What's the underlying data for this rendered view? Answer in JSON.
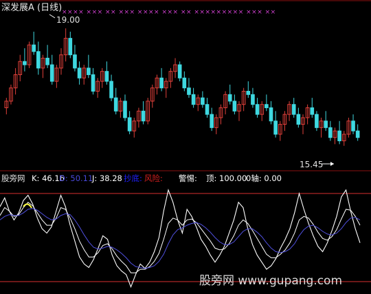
{
  "chart_data": [
    {
      "type": "candlestick",
      "title": "深发展A (日线)",
      "ylim": [
        14.8,
        19.4
      ],
      "high_label": "19.00",
      "low_label": "15.45",
      "colors": {
        "up": "#e0403a",
        "down": "#3fd8e0",
        "signal": "#d040d0"
      },
      "signal_row": "×××× ××× ×× ××× ×××× ××× ×× ××××××××× ××× ××",
      "candles": [
        [
          16.6,
          16.9,
          16.4,
          16.8
        ],
        [
          16.8,
          17.3,
          16.7,
          17.2
        ],
        [
          17.2,
          17.8,
          17.0,
          17.6
        ],
        [
          17.6,
          18.2,
          17.4,
          18.0
        ],
        [
          18.0,
          18.4,
          17.7,
          17.9
        ],
        [
          17.9,
          18.6,
          17.8,
          18.5
        ],
        [
          18.5,
          18.9,
          18.2,
          18.3
        ],
        [
          18.3,
          18.6,
          17.6,
          17.8
        ],
        [
          17.8,
          18.2,
          17.5,
          18.1
        ],
        [
          18.1,
          18.5,
          17.8,
          17.9
        ],
        [
          17.9,
          18.2,
          17.3,
          17.4
        ],
        [
          17.4,
          17.9,
          17.2,
          17.8
        ],
        [
          17.8,
          18.4,
          17.6,
          18.2
        ],
        [
          18.2,
          19.0,
          18.0,
          18.7
        ],
        [
          18.7,
          18.9,
          18.1,
          18.2
        ],
        [
          18.2,
          18.5,
          17.7,
          17.8
        ],
        [
          17.8,
          18.0,
          17.3,
          17.5
        ],
        [
          17.5,
          17.9,
          17.3,
          17.8
        ],
        [
          17.8,
          18.2,
          17.5,
          17.6
        ],
        [
          17.6,
          17.8,
          17.0,
          17.1
        ],
        [
          17.1,
          17.5,
          16.9,
          17.4
        ],
        [
          17.4,
          17.8,
          17.2,
          17.7
        ],
        [
          17.7,
          18.0,
          17.3,
          17.4
        ],
        [
          17.4,
          17.6,
          16.8,
          16.9
        ],
        [
          16.9,
          17.2,
          16.4,
          16.5
        ],
        [
          16.5,
          16.9,
          16.3,
          16.8
        ],
        [
          16.8,
          17.0,
          16.2,
          16.3
        ],
        [
          16.3,
          16.5,
          15.8,
          15.9
        ],
        [
          15.9,
          16.3,
          15.7,
          16.2
        ],
        [
          16.2,
          16.6,
          16.0,
          16.5
        ],
        [
          16.5,
          16.8,
          16.1,
          16.2
        ],
        [
          16.2,
          16.9,
          16.1,
          16.8
        ],
        [
          16.8,
          17.3,
          16.6,
          17.2
        ],
        [
          17.2,
          17.6,
          17.0,
          17.5
        ],
        [
          17.5,
          17.8,
          17.1,
          17.2
        ],
        [
          17.2,
          17.5,
          16.9,
          17.4
        ],
        [
          17.4,
          17.8,
          17.2,
          17.7
        ],
        [
          17.7,
          18.1,
          17.5,
          17.9
        ],
        [
          17.9,
          18.0,
          17.4,
          17.5
        ],
        [
          17.5,
          17.7,
          17.1,
          17.2
        ],
        [
          17.2,
          17.5,
          16.9,
          17.0
        ],
        [
          17.0,
          17.2,
          16.6,
          16.7
        ],
        [
          16.7,
          17.0,
          16.5,
          16.9
        ],
        [
          16.9,
          17.1,
          16.6,
          16.7
        ],
        [
          16.7,
          16.9,
          16.3,
          16.4
        ],
        [
          16.4,
          16.6,
          15.9,
          16.0
        ],
        [
          16.0,
          16.4,
          15.8,
          16.3
        ],
        [
          16.3,
          16.7,
          16.1,
          16.6
        ],
        [
          16.6,
          17.1,
          16.4,
          17.0
        ],
        [
          17.0,
          17.3,
          16.7,
          16.8
        ],
        [
          16.8,
          17.0,
          16.4,
          16.5
        ],
        [
          16.5,
          16.8,
          16.2,
          16.7
        ],
        [
          16.7,
          17.2,
          16.5,
          17.1
        ],
        [
          17.1,
          17.4,
          16.9,
          17.0
        ],
        [
          17.0,
          17.2,
          16.6,
          16.7
        ],
        [
          16.7,
          16.9,
          16.3,
          16.4
        ],
        [
          16.4,
          16.8,
          16.2,
          16.7
        ],
        [
          16.7,
          17.0,
          16.5,
          16.6
        ],
        [
          16.6,
          16.8,
          16.1,
          16.2
        ],
        [
          16.2,
          16.5,
          15.7,
          15.8
        ],
        [
          15.8,
          16.2,
          15.6,
          16.1
        ],
        [
          16.1,
          16.5,
          15.9,
          16.4
        ],
        [
          16.4,
          16.8,
          16.2,
          16.7
        ],
        [
          16.7,
          16.9,
          16.3,
          16.4
        ],
        [
          16.4,
          16.6,
          16.0,
          16.1
        ],
        [
          16.1,
          16.4,
          15.8,
          16.3
        ],
        [
          16.3,
          16.7,
          16.1,
          16.6
        ],
        [
          16.6,
          16.9,
          16.3,
          16.4
        ],
        [
          16.4,
          16.5,
          15.9,
          16.0
        ],
        [
          16.0,
          16.3,
          15.7,
          16.2
        ],
        [
          16.2,
          16.5,
          15.9,
          16.0
        ],
        [
          16.0,
          16.2,
          15.6,
          15.7
        ],
        [
          15.7,
          16.0,
          15.5,
          15.9
        ],
        [
          15.9,
          16.2,
          15.5,
          15.6
        ],
        [
          15.6,
          15.9,
          15.45,
          15.8
        ],
        [
          15.8,
          16.3,
          15.7,
          16.2
        ],
        [
          16.2,
          16.4,
          15.8,
          15.9
        ],
        [
          15.9,
          16.1,
          15.6,
          15.7
        ]
      ]
    },
    {
      "type": "line",
      "indicator": "股旁网",
      "legend": [
        {
          "name": "K",
          "value": "46.16",
          "color": "#ffffff"
        },
        {
          "name": "D",
          "value": "50.11",
          "color": "#4848d8"
        },
        {
          "name": "J",
          "value": "38.28",
          "color": "#ffffff"
        },
        {
          "name": "抄底",
          "value": "",
          "color": "#2020ff"
        },
        {
          "name": "风险",
          "value": "",
          "color": "#d82020"
        },
        {
          "name": "警惕",
          "value": "",
          "color": "#ffffff"
        },
        {
          "name": "顶",
          "value": "100.00",
          "color": "#ffffff"
        },
        {
          "name": "0轴",
          "value": "0.00",
          "color": "#ffffff"
        }
      ],
      "ylim": [
        -8,
        110
      ],
      "reference_lines": [
        100,
        0
      ],
      "series": [
        {
          "name": "J",
          "color": "#ffffff",
          "values": [
            85,
            95,
            80,
            70,
            78,
            92,
            98,
            88,
            72,
            60,
            55,
            62,
            80,
            98,
            85,
            64,
            46,
            28,
            20,
            16,
            25,
            38,
            52,
            48,
            30,
            18,
            12,
            8,
            -6,
            8,
            20,
            15,
            22,
            34,
            50,
            80,
            104,
            90,
            70,
            55,
            82,
            74,
            62,
            48,
            40,
            30,
            22,
            30,
            40,
            55,
            70,
            90,
            84,
            60,
            42,
            30,
            22,
            14,
            18,
            26,
            38,
            48,
            60,
            78,
            100,
            82,
            66,
            52,
            40,
            34,
            44,
            58,
            74,
            96,
            104,
            80,
            60,
            44
          ]
        },
        {
          "name": "K",
          "color": "#ffffff",
          "values": [
            75,
            84,
            80,
            74,
            76,
            84,
            90,
            86,
            78,
            70,
            64,
            64,
            72,
            84,
            82,
            72,
            60,
            46,
            36,
            28,
            28,
            33,
            41,
            43,
            37,
            29,
            23,
            18,
            10,
            10,
            14,
            14,
            17,
            23,
            32,
            48,
            66,
            72,
            70,
            64,
            70,
            71,
            67,
            60,
            53,
            46,
            38,
            36,
            37,
            43,
            52,
            64,
            70,
            66,
            58,
            49,
            40,
            31,
            27,
            27,
            31,
            36,
            44,
            55,
            70,
            74,
            72,
            65,
            56,
            49,
            47,
            51,
            59,
            71,
            82,
            81,
            74,
            64
          ]
        },
        {
          "name": "D",
          "color": "#5050e0",
          "values": [
            70,
            74,
            76,
            75,
            75,
            78,
            82,
            83,
            81,
            77,
            73,
            70,
            71,
            75,
            77,
            76,
            70,
            62,
            53,
            45,
            39,
            37,
            38,
            40,
            39,
            36,
            32,
            27,
            21,
            17,
            16,
            15,
            16,
            18,
            23,
            31,
            43,
            53,
            59,
            61,
            64,
            66,
            67,
            65,
            61,
            56,
            50,
            45,
            42,
            42,
            45,
            51,
            57,
            60,
            60,
            56,
            51,
            44,
            38,
            34,
            33,
            34,
            37,
            43,
            52,
            59,
            63,
            64,
            61,
            57,
            54,
            53,
            55,
            60,
            67,
            72,
            73,
            70
          ]
        },
        {
          "name": "信号",
          "color": "#ffff40",
          "values": [
            null,
            null,
            null,
            null,
            null,
            null,
            null,
            null,
            null,
            null,
            null,
            null,
            null,
            null,
            null,
            null,
            null,
            null,
            null,
            null,
            null,
            null,
            null,
            null,
            null,
            null,
            null,
            null,
            null,
            null,
            null,
            null,
            null,
            null,
            null,
            null,
            null,
            null,
            null,
            null,
            null,
            null,
            null,
            null,
            null,
            null,
            null,
            null,
            null,
            null,
            null,
            null,
            null,
            null,
            null,
            null,
            null,
            null,
            null,
            null,
            null,
            null,
            null,
            null,
            null,
            null,
            null,
            null,
            null,
            null,
            null,
            null,
            null,
            null,
            null,
            null,
            null,
            null
          ]
        }
      ]
    }
  ],
  "watermark": "股旁网 www.gupang.com"
}
